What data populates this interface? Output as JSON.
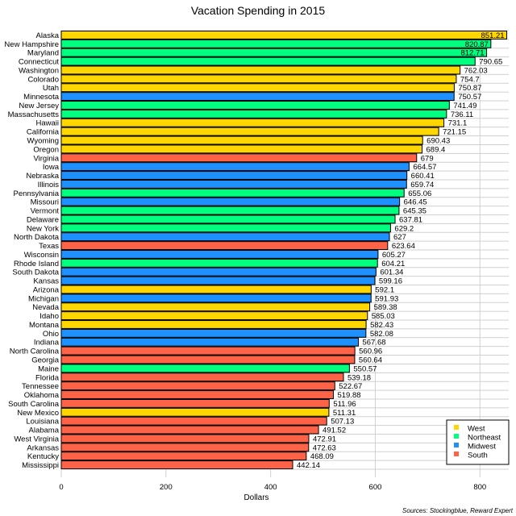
{
  "chart_data": {
    "type": "bar",
    "orientation": "horizontal",
    "title": "Vacation Spending in 2015",
    "xlabel": "Dollars",
    "ylabel": "",
    "xlim": [
      0,
      855
    ],
    "xticks": [
      0,
      200,
      400,
      600,
      800
    ],
    "grid": true,
    "legend_position": "bottom-right",
    "source": "Sources: Stockingblue, Reward Expert",
    "region_colors": {
      "West": "#FFD700",
      "Northeast": "#00FF7F",
      "Midwest": "#1E90FF",
      "South": "#FF6347"
    },
    "legend": [
      "West",
      "Northeast",
      "Midwest",
      "South"
    ],
    "bars": [
      {
        "state": "Alaska",
        "value": 851.21,
        "label": "851.21",
        "region": "West"
      },
      {
        "state": "New Hampshire",
        "value": 820.87,
        "label": "820.87",
        "region": "Northeast"
      },
      {
        "state": "Maryland",
        "value": 812.71,
        "label": "812.71",
        "region": "Northeast"
      },
      {
        "state": "Connecticut",
        "value": 790.65,
        "label": "790.65",
        "region": "Northeast"
      },
      {
        "state": "Washington",
        "value": 762.03,
        "label": "762.03",
        "region": "West"
      },
      {
        "state": "Colorado",
        "value": 754.7,
        "label": "754.7",
        "region": "West"
      },
      {
        "state": "Utah",
        "value": 750.87,
        "label": "750.87",
        "region": "West"
      },
      {
        "state": "Minnesota",
        "value": 750.57,
        "label": "750.57",
        "region": "Midwest"
      },
      {
        "state": "New Jersey",
        "value": 741.49,
        "label": "741.49",
        "region": "Northeast"
      },
      {
        "state": "Massachusetts",
        "value": 736.11,
        "label": "736.11",
        "region": "Northeast"
      },
      {
        "state": "Hawaii",
        "value": 731.1,
        "label": "731.1",
        "region": "West"
      },
      {
        "state": "California",
        "value": 721.15,
        "label": "721.15",
        "region": "West"
      },
      {
        "state": "Wyoming",
        "value": 690.43,
        "label": "690.43",
        "region": "West"
      },
      {
        "state": "Oregon",
        "value": 689.4,
        "label": "689.4",
        "region": "West"
      },
      {
        "state": "Virginia",
        "value": 679,
        "label": "679",
        "region": "South"
      },
      {
        "state": "Iowa",
        "value": 664.57,
        "label": "664.57",
        "region": "Midwest"
      },
      {
        "state": "Nebraska",
        "value": 660.41,
        "label": "660.41",
        "region": "Midwest"
      },
      {
        "state": "Illinois",
        "value": 659.74,
        "label": "659.74",
        "region": "Midwest"
      },
      {
        "state": "Pennsylvania",
        "value": 655.06,
        "label": "655.06",
        "region": "Northeast"
      },
      {
        "state": "Missouri",
        "value": 646.45,
        "label": "646.45",
        "region": "Midwest"
      },
      {
        "state": "Vermont",
        "value": 645.35,
        "label": "645.35",
        "region": "Northeast"
      },
      {
        "state": "Delaware",
        "value": 637.81,
        "label": "637.81",
        "region": "Northeast"
      },
      {
        "state": "New York",
        "value": 629.2,
        "label": "629.2",
        "region": "Northeast"
      },
      {
        "state": "North Dakota",
        "value": 627,
        "label": "627",
        "region": "Midwest"
      },
      {
        "state": "Texas",
        "value": 623.64,
        "label": "623.64",
        "region": "South"
      },
      {
        "state": "Wisconsin",
        "value": 605.27,
        "label": "605.27",
        "region": "Midwest"
      },
      {
        "state": "Rhode Island",
        "value": 604.21,
        "label": "604.21",
        "region": "Northeast"
      },
      {
        "state": "South Dakota",
        "value": 601.34,
        "label": "601.34",
        "region": "Midwest"
      },
      {
        "state": "Kansas",
        "value": 599.16,
        "label": "599.16",
        "region": "Midwest"
      },
      {
        "state": "Arizona",
        "value": 592.1,
        "label": "592.1",
        "region": "West"
      },
      {
        "state": "Michigan",
        "value": 591.93,
        "label": "591.93",
        "region": "Midwest"
      },
      {
        "state": "Nevada",
        "value": 589.38,
        "label": "589.38",
        "region": "West"
      },
      {
        "state": "Idaho",
        "value": 585.03,
        "label": "585.03",
        "region": "West"
      },
      {
        "state": "Montana",
        "value": 582.43,
        "label": "582.43",
        "region": "West"
      },
      {
        "state": "Ohio",
        "value": 582.08,
        "label": "582.08",
        "region": "Midwest"
      },
      {
        "state": "Indiana",
        "value": 567.68,
        "label": "567.68",
        "region": "Midwest"
      },
      {
        "state": "North Carolina",
        "value": 560.96,
        "label": "560.96",
        "region": "South"
      },
      {
        "state": "Georgia",
        "value": 560.64,
        "label": "560.64",
        "region": "South"
      },
      {
        "state": "Maine",
        "value": 550.57,
        "label": "550.57",
        "region": "Northeast"
      },
      {
        "state": "Florida",
        "value": 539.18,
        "label": "539.18",
        "region": "South"
      },
      {
        "state": "Tennessee",
        "value": 522.67,
        "label": "522.67",
        "region": "South"
      },
      {
        "state": "Oklahoma",
        "value": 519.88,
        "label": "519.88",
        "region": "South"
      },
      {
        "state": "South Carolina",
        "value": 511.96,
        "label": "511.96",
        "region": "South"
      },
      {
        "state": "New Mexico",
        "value": 511.31,
        "label": "511.31",
        "region": "West"
      },
      {
        "state": "Louisiana",
        "value": 507.13,
        "label": "507.13",
        "region": "South"
      },
      {
        "state": "Alabama",
        "value": 491.52,
        "label": "491.52",
        "region": "South"
      },
      {
        "state": "West Virginia",
        "value": 472.91,
        "label": "472.91",
        "region": "South"
      },
      {
        "state": "Arkansas",
        "value": 472.63,
        "label": "472.63",
        "region": "South"
      },
      {
        "state": "Kentucky",
        "value": 468.09,
        "label": "468.09",
        "region": "South"
      },
      {
        "state": "Mississippi",
        "value": 442.14,
        "label": "442.14",
        "region": "South"
      }
    ]
  }
}
